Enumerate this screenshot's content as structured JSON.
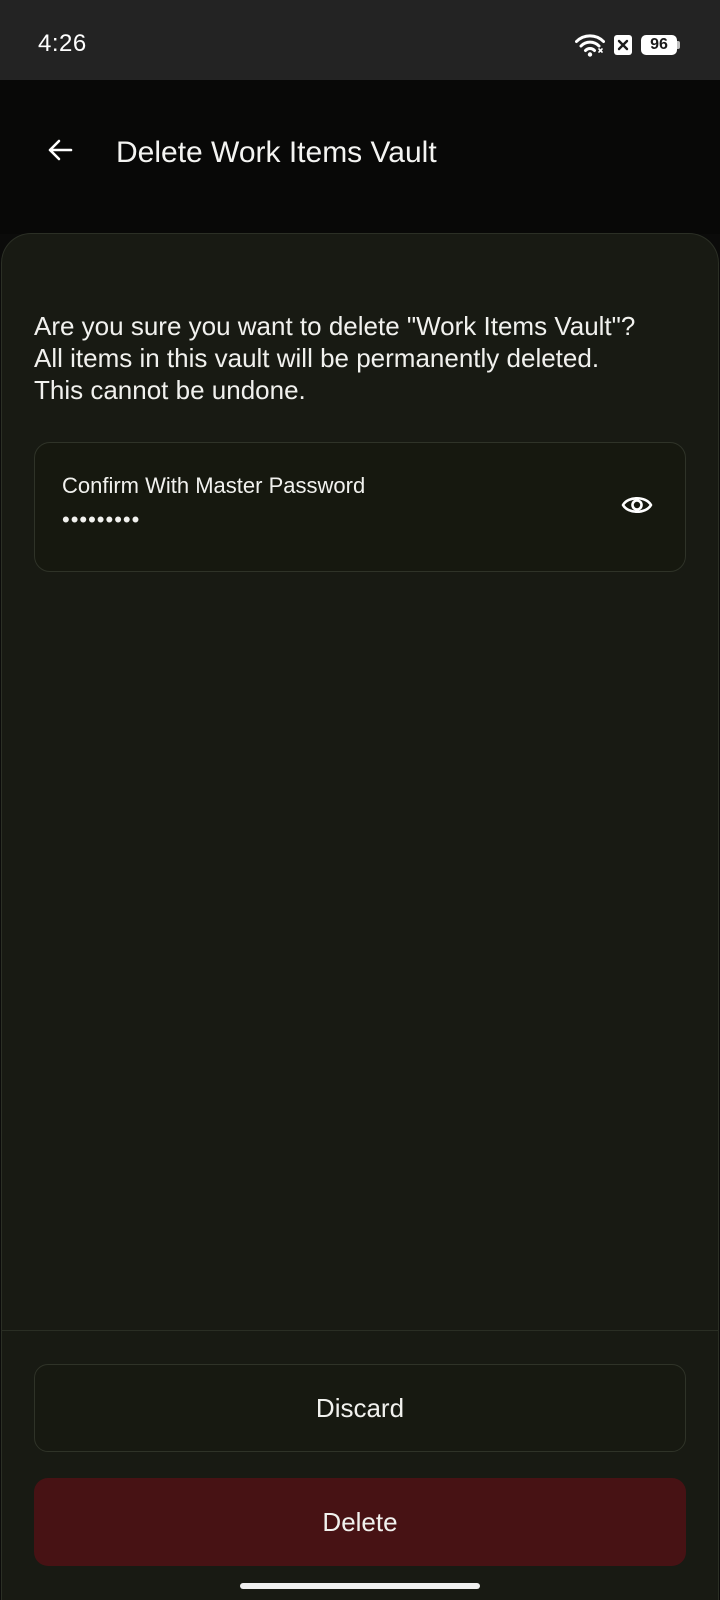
{
  "status_bar": {
    "time": "4:26",
    "battery_level": "96",
    "icons": [
      "wifi-icon",
      "close-box-icon",
      "battery-icon"
    ]
  },
  "header": {
    "back_icon": "arrow-left-icon",
    "title": "Delete Work Items Vault"
  },
  "body": {
    "warning_line_1": "Are you sure you want to delete \"Work Items Vault\"?",
    "warning_line_2": "All items in this vault will be permanently deleted.",
    "warning_line_3": "This cannot be undone."
  },
  "password_field": {
    "label": "Confirm With Master Password",
    "masked_value": "•••••••••",
    "toggle_icon": "eye-icon"
  },
  "footer": {
    "discard_label": "Discard",
    "delete_label": "Delete"
  },
  "colors": {
    "background": "#0b0b0a",
    "sheet": "#181a13",
    "status_bar": "#232323",
    "delete_button": "#471214",
    "border": "#2f3328",
    "text": "#f1f1ee"
  }
}
